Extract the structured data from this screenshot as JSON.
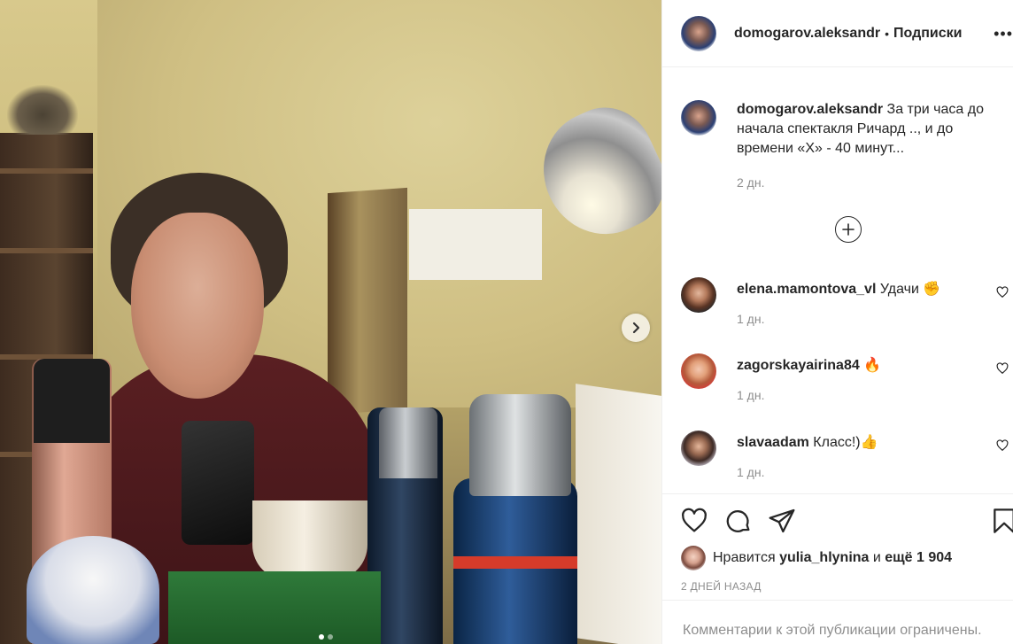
{
  "post": {
    "author": "domogarov.aleksandr",
    "separator": "•",
    "follow_label": "Подписки",
    "more_label": "•••",
    "caption_text": "За три часа до начала спектакля Ричард .., и до времени «Х» - 40 минут...",
    "caption_time": "2 дн.",
    "likes_prefix": "Нравится",
    "likes_user": "yulia_hlynina",
    "likes_and": "и",
    "likes_count": "ещё 1 904",
    "date": "2 ДНЕЙ НАЗАД",
    "comments_disabled": "Комментарии к этой публикации ограничены."
  },
  "comments": [
    {
      "user": "elena.mamontova_vl",
      "text": "Удачи ✊",
      "time": "1 дн."
    },
    {
      "user": "zagorskayairina84",
      "text": "🔥",
      "time": "1 дн."
    },
    {
      "user": "slavaadam",
      "text": "Класс!)👍",
      "time": "1 дн."
    }
  ],
  "carousel": {
    "current": 1,
    "total": 2
  },
  "icons": {
    "next": "chevron-right-icon",
    "load_more": "plus-circle-icon",
    "like": "heart-icon",
    "comment": "comment-icon",
    "share": "paper-plane-icon",
    "save": "bookmark-icon"
  }
}
